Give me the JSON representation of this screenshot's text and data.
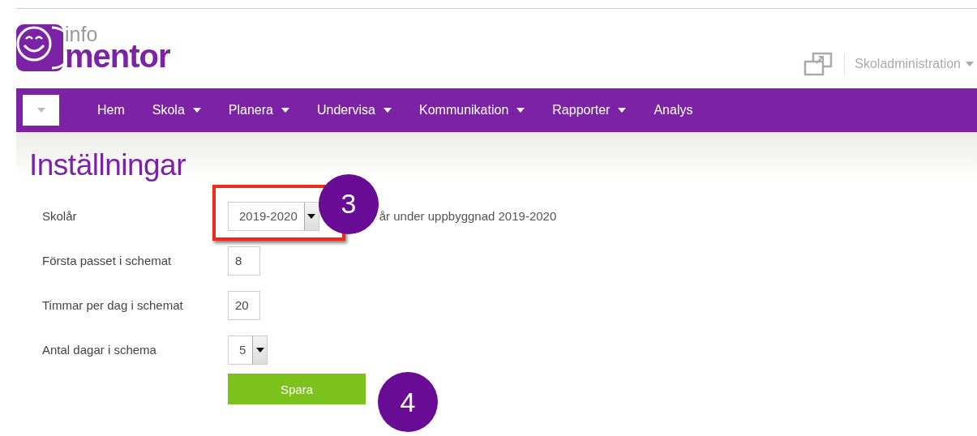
{
  "logo": {
    "top": "info",
    "bottom": "mentor"
  },
  "user_menu": {
    "label": "Skoladministration"
  },
  "nav": {
    "items": [
      {
        "label": "Hem",
        "dropdown": false
      },
      {
        "label": "Skola",
        "dropdown": true
      },
      {
        "label": "Planera",
        "dropdown": true
      },
      {
        "label": "Undervisa",
        "dropdown": true
      },
      {
        "label": "Kommunikation",
        "dropdown": true
      },
      {
        "label": "Rapporter",
        "dropdown": true
      },
      {
        "label": "Analys",
        "dropdown": false
      }
    ]
  },
  "page_title": "Inställningar",
  "form": {
    "rows": [
      {
        "kind": "select",
        "label": "Skolår",
        "value": "2019-2020",
        "note": "år under uppbyggnad 2019-2020",
        "highlighted": true,
        "callout": "3"
      },
      {
        "kind": "number",
        "label": "Första passet i schemat",
        "value": "8",
        "highlighted": false
      },
      {
        "kind": "number",
        "label": "Timmar per dag i schemat",
        "value": "20",
        "highlighted": false
      },
      {
        "kind": "select",
        "label": "Antal dagar i schema",
        "value": "5",
        "highlighted": false
      }
    ],
    "save_button": {
      "label": "Spara",
      "callout": "4"
    }
  }
}
